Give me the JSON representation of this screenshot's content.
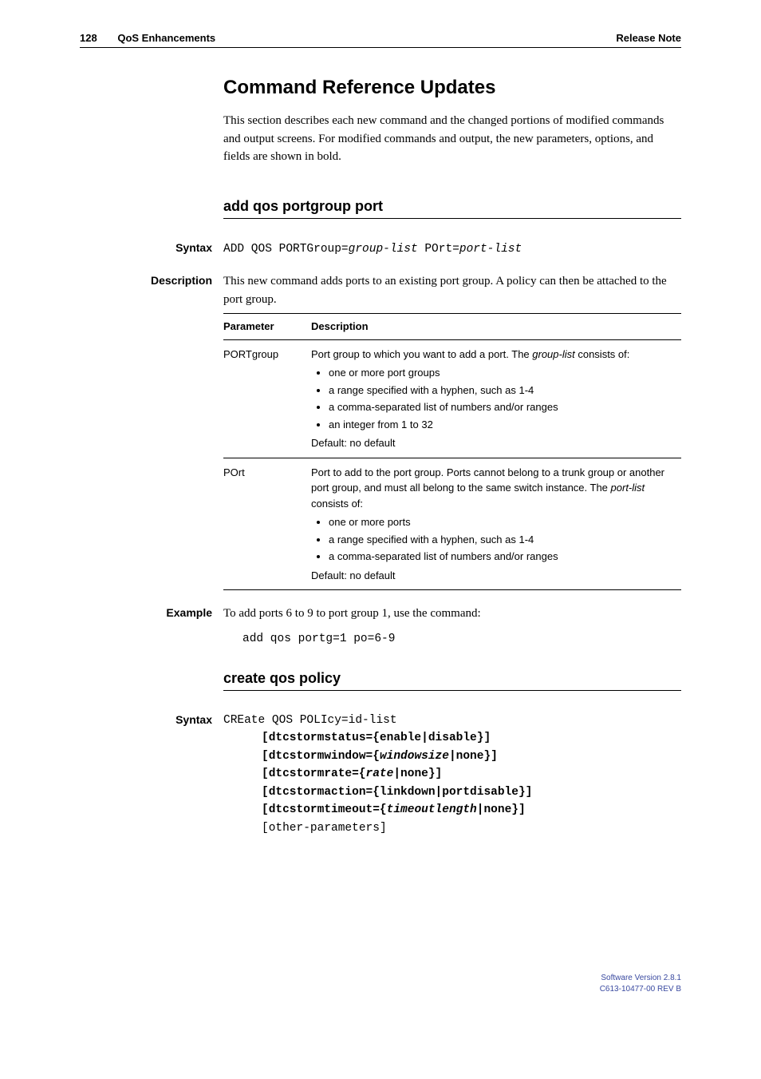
{
  "header": {
    "page_number": "128",
    "section": "QoS Enhancements",
    "doc_type": "Release Note"
  },
  "title": "Command Reference Updates",
  "intro": "This section describes each new command and the changed portions of modified commands and output screens. For modified commands and output, the new parameters, options, and fields are shown in bold.",
  "cmd1": {
    "heading": "add qos portgroup port",
    "syntax_label": "Syntax",
    "syntax_prefix": "ADD QOS PORTGroup=",
    "syntax_arg1": "group-list",
    "syntax_mid": " POrt=",
    "syntax_arg2": "port-list",
    "desc_label": "Description",
    "desc_text": "This new command adds ports to an existing port group. A policy can then be attached to the port group.",
    "table": {
      "h1": "Parameter",
      "h2": "Description",
      "r1_param": "PORTgroup",
      "r1_lead": "Port group to which you want to add a port. The ",
      "r1_it": "group-list",
      "r1_tail": " consists of:",
      "r1_b1": "one or more port groups",
      "r1_b2": "a range specified with a hyphen, such as 1-4",
      "r1_b3": "a comma-separated list of numbers and/or ranges",
      "r1_b4": "an integer from 1 to 32",
      "r1_def": "Default: no default",
      "r2_param": "POrt",
      "r2_lead": "Port to add to the port group. Ports cannot belong to a trunk group or another port group, and must all belong to the same switch instance. The ",
      "r2_it": "port-list",
      "r2_tail": " consists of:",
      "r2_b1": "one or more ports",
      "r2_b2": "a range specified with a hyphen, such as 1-4",
      "r2_b3": "a comma-separated list of numbers and/or ranges",
      "r2_def": "Default: no default"
    },
    "example_label": "Example",
    "example_text": "To add ports 6 to 9 to port group 1, use the command:",
    "example_cmd": "add qos portg=1 po=6-9"
  },
  "cmd2": {
    "heading": "create qos policy",
    "syntax_label": "Syntax",
    "line1_a": "CREate QOS POLIcy=",
    "line1_b": "id-list",
    "line2": "[dtcstormstatus={enable|disable}]",
    "line3_a": "[dtcstormwindow={",
    "line3_b": "windowsize",
    "line3_c": "|none}]",
    "line4_a": "[dtcstormrate={",
    "line4_b": "rate",
    "line4_c": "|none}]",
    "line5": "[dtcstormaction={linkdown|portdisable}]",
    "line6_a": "[dtcstormtimeout={",
    "line6_b": "timeoutlength",
    "line6_c": "|none}]",
    "line7_a": "[",
    "line7_b": "other-parameters",
    "line7_c": "]"
  },
  "footer": {
    "line1": "Software Version 2.8.1",
    "line2": "C613-10477-00 REV B"
  }
}
